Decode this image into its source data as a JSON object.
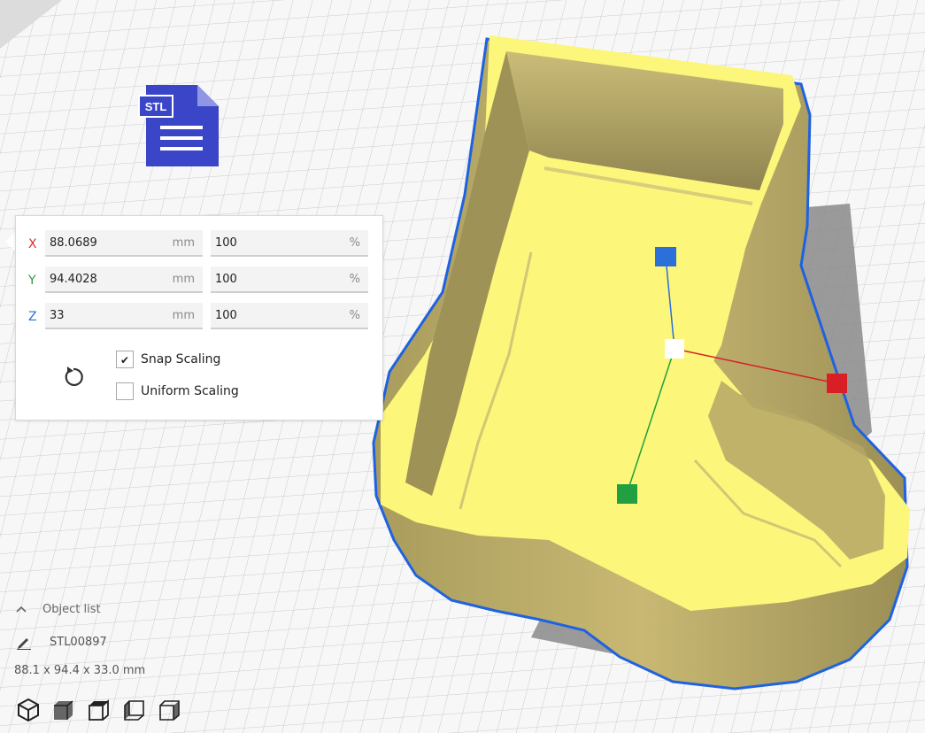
{
  "stl_icon": {
    "text": "STL",
    "color": "#3a45c8"
  },
  "scale_tool": {
    "rows": [
      {
        "axis": "X",
        "mm": "88.0689",
        "mm_unit": "mm",
        "percent": "100",
        "percent_unit": "%"
      },
      {
        "axis": "Y",
        "mm": "94.4028",
        "mm_unit": "mm",
        "percent": "100",
        "percent_unit": "%"
      },
      {
        "axis": "Z",
        "mm": "33",
        "mm_unit": "mm",
        "percent": "100",
        "percent_unit": "%"
      }
    ],
    "snap_scaling": {
      "label": "Snap Scaling",
      "checked": true
    },
    "uniform_scaling": {
      "label": "Uniform Scaling",
      "checked": false
    },
    "reset_icon": "reset-icon"
  },
  "object_list": {
    "header": "Object list",
    "object_name": "STL00897",
    "dimensions": "88.1 x 94.4 x 33.0 mm"
  },
  "view_buttons": [
    "3d-view-icon",
    "front-view-icon",
    "top-view-icon",
    "left-view-icon",
    "right-view-icon"
  ],
  "colors": {
    "model_top": "#fcf67a",
    "model_wall": "#b9a966",
    "outline": "#1f62e0",
    "handle_x": "#d91f26",
    "handle_y": "#20a040",
    "handle_z": "#2b6fd9",
    "grid": "#c7c7c7"
  }
}
